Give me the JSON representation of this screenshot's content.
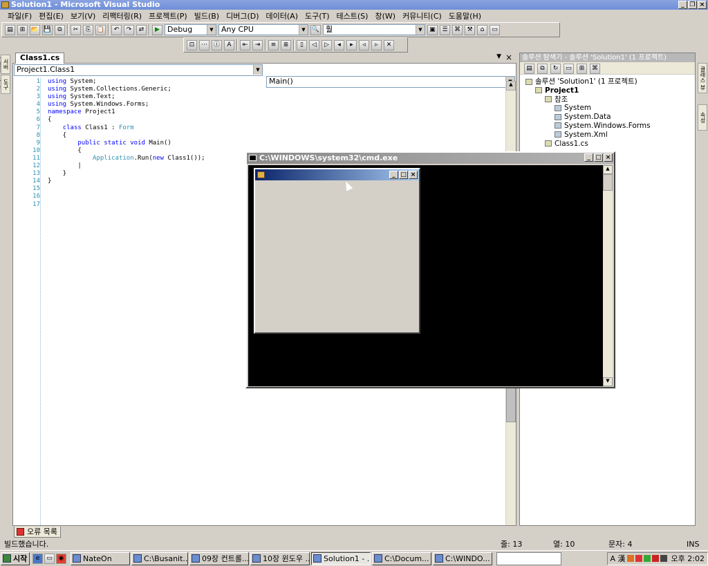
{
  "window": {
    "title": "Solution1 - Microsoft Visual Studio"
  },
  "menu": [
    "파일(F)",
    "편집(E)",
    "보기(V)",
    "리팩터링(R)",
    "프로젝트(P)",
    "빌드(B)",
    "디버그(D)",
    "데이터(A)",
    "도구(T)",
    "테스트(S)",
    "창(W)",
    "커뮤니티(C)",
    "도움말(H)"
  ],
  "toolbar": {
    "config": "Debug",
    "platform": "Any CPU",
    "find": "훨"
  },
  "left_tabs": [
    "서버 탐색기",
    "도구 상자"
  ],
  "editor": {
    "tab": "Class1.cs",
    "class_combo": "Project1.Class1",
    "member_combo": "Main()",
    "lines": [
      {
        "n": "1",
        "text": "using System;"
      },
      {
        "n": "2",
        "text": "using System.Collections.Generic;"
      },
      {
        "n": "3",
        "text": "using System.Text;"
      },
      {
        "n": "4",
        "text": "using System.Windows.Forms;"
      },
      {
        "n": "5",
        "text": ""
      },
      {
        "n": "6",
        "text": "namespace Project1"
      },
      {
        "n": "7",
        "text": "{"
      },
      {
        "n": "8",
        "text": "    class Class1 : Form"
      },
      {
        "n": "9",
        "text": "    {"
      },
      {
        "n": "10",
        "text": "        public static void Main()"
      },
      {
        "n": "11",
        "text": "        {"
      },
      {
        "n": "12",
        "text": "            Application.Run(new Class1());"
      },
      {
        "n": "13",
        "text": "        |"
      },
      {
        "n": "14",
        "text": "    }"
      },
      {
        "n": "15",
        "text": "}"
      },
      {
        "n": "16",
        "text": ""
      },
      {
        "n": "17",
        "text": ""
      }
    ]
  },
  "solution_explorer": {
    "title": "솔루션 탐색기 - 솔루션 'Solution1' (1 프로젝트)",
    "items": [
      {
        "label": "솔루션 'Solution1' (1 프로젝트)",
        "depth": 0,
        "bold": false
      },
      {
        "label": "Project1",
        "depth": 1,
        "bold": true
      },
      {
        "label": "참조",
        "depth": 2,
        "bold": false
      },
      {
        "label": "System",
        "depth": 3,
        "bold": false
      },
      {
        "label": "System.Data",
        "depth": 3,
        "bold": false
      },
      {
        "label": "System.Windows.Forms",
        "depth": 3,
        "bold": false
      },
      {
        "label": "System.Xml",
        "depth": 3,
        "bold": false
      },
      {
        "label": "Class1.cs",
        "depth": 2,
        "bold": false
      }
    ]
  },
  "right_tabs": [
    "클래스 뷰",
    "속성"
  ],
  "cmd_window": {
    "title": "C:\\WINDOWS\\system32\\cmd.exe"
  },
  "bottom_tab": "오류 목록",
  "status": {
    "message": "빌드했습니다.",
    "line": "줄: 13",
    "col": "열: 10",
    "char": "문자: 4",
    "mode": "INS"
  },
  "taskbar": {
    "start": "시작",
    "buttons": [
      "NateOn",
      "C:\\Busanit...",
      "09장 컨트롤...",
      "10장 윈도우 ...",
      "Solution1 - ...",
      "C:\\Docum...",
      "C:\\WINDO..."
    ],
    "clock": "오후 2:02"
  }
}
